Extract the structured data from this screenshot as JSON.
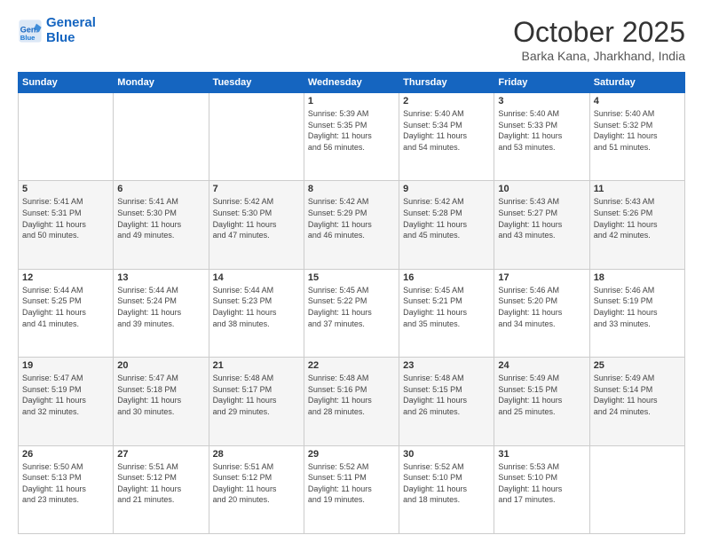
{
  "logo": {
    "line1": "General",
    "line2": "Blue"
  },
  "title": "October 2025",
  "location": "Barka Kana, Jharkhand, India",
  "days_of_week": [
    "Sunday",
    "Monday",
    "Tuesday",
    "Wednesday",
    "Thursday",
    "Friday",
    "Saturday"
  ],
  "weeks": [
    [
      {
        "day": "",
        "text": ""
      },
      {
        "day": "",
        "text": ""
      },
      {
        "day": "",
        "text": ""
      },
      {
        "day": "1",
        "text": "Sunrise: 5:39 AM\nSunset: 5:35 PM\nDaylight: 11 hours\nand 56 minutes."
      },
      {
        "day": "2",
        "text": "Sunrise: 5:40 AM\nSunset: 5:34 PM\nDaylight: 11 hours\nand 54 minutes."
      },
      {
        "day": "3",
        "text": "Sunrise: 5:40 AM\nSunset: 5:33 PM\nDaylight: 11 hours\nand 53 minutes."
      },
      {
        "day": "4",
        "text": "Sunrise: 5:40 AM\nSunset: 5:32 PM\nDaylight: 11 hours\nand 51 minutes."
      }
    ],
    [
      {
        "day": "5",
        "text": "Sunrise: 5:41 AM\nSunset: 5:31 PM\nDaylight: 11 hours\nand 50 minutes."
      },
      {
        "day": "6",
        "text": "Sunrise: 5:41 AM\nSunset: 5:30 PM\nDaylight: 11 hours\nand 49 minutes."
      },
      {
        "day": "7",
        "text": "Sunrise: 5:42 AM\nSunset: 5:30 PM\nDaylight: 11 hours\nand 47 minutes."
      },
      {
        "day": "8",
        "text": "Sunrise: 5:42 AM\nSunset: 5:29 PM\nDaylight: 11 hours\nand 46 minutes."
      },
      {
        "day": "9",
        "text": "Sunrise: 5:42 AM\nSunset: 5:28 PM\nDaylight: 11 hours\nand 45 minutes."
      },
      {
        "day": "10",
        "text": "Sunrise: 5:43 AM\nSunset: 5:27 PM\nDaylight: 11 hours\nand 43 minutes."
      },
      {
        "day": "11",
        "text": "Sunrise: 5:43 AM\nSunset: 5:26 PM\nDaylight: 11 hours\nand 42 minutes."
      }
    ],
    [
      {
        "day": "12",
        "text": "Sunrise: 5:44 AM\nSunset: 5:25 PM\nDaylight: 11 hours\nand 41 minutes."
      },
      {
        "day": "13",
        "text": "Sunrise: 5:44 AM\nSunset: 5:24 PM\nDaylight: 11 hours\nand 39 minutes."
      },
      {
        "day": "14",
        "text": "Sunrise: 5:44 AM\nSunset: 5:23 PM\nDaylight: 11 hours\nand 38 minutes."
      },
      {
        "day": "15",
        "text": "Sunrise: 5:45 AM\nSunset: 5:22 PM\nDaylight: 11 hours\nand 37 minutes."
      },
      {
        "day": "16",
        "text": "Sunrise: 5:45 AM\nSunset: 5:21 PM\nDaylight: 11 hours\nand 35 minutes."
      },
      {
        "day": "17",
        "text": "Sunrise: 5:46 AM\nSunset: 5:20 PM\nDaylight: 11 hours\nand 34 minutes."
      },
      {
        "day": "18",
        "text": "Sunrise: 5:46 AM\nSunset: 5:19 PM\nDaylight: 11 hours\nand 33 minutes."
      }
    ],
    [
      {
        "day": "19",
        "text": "Sunrise: 5:47 AM\nSunset: 5:19 PM\nDaylight: 11 hours\nand 32 minutes."
      },
      {
        "day": "20",
        "text": "Sunrise: 5:47 AM\nSunset: 5:18 PM\nDaylight: 11 hours\nand 30 minutes."
      },
      {
        "day": "21",
        "text": "Sunrise: 5:48 AM\nSunset: 5:17 PM\nDaylight: 11 hours\nand 29 minutes."
      },
      {
        "day": "22",
        "text": "Sunrise: 5:48 AM\nSunset: 5:16 PM\nDaylight: 11 hours\nand 28 minutes."
      },
      {
        "day": "23",
        "text": "Sunrise: 5:48 AM\nSunset: 5:15 PM\nDaylight: 11 hours\nand 26 minutes."
      },
      {
        "day": "24",
        "text": "Sunrise: 5:49 AM\nSunset: 5:15 PM\nDaylight: 11 hours\nand 25 minutes."
      },
      {
        "day": "25",
        "text": "Sunrise: 5:49 AM\nSunset: 5:14 PM\nDaylight: 11 hours\nand 24 minutes."
      }
    ],
    [
      {
        "day": "26",
        "text": "Sunrise: 5:50 AM\nSunset: 5:13 PM\nDaylight: 11 hours\nand 23 minutes."
      },
      {
        "day": "27",
        "text": "Sunrise: 5:51 AM\nSunset: 5:12 PM\nDaylight: 11 hours\nand 21 minutes."
      },
      {
        "day": "28",
        "text": "Sunrise: 5:51 AM\nSunset: 5:12 PM\nDaylight: 11 hours\nand 20 minutes."
      },
      {
        "day": "29",
        "text": "Sunrise: 5:52 AM\nSunset: 5:11 PM\nDaylight: 11 hours\nand 19 minutes."
      },
      {
        "day": "30",
        "text": "Sunrise: 5:52 AM\nSunset: 5:10 PM\nDaylight: 11 hours\nand 18 minutes."
      },
      {
        "day": "31",
        "text": "Sunrise: 5:53 AM\nSunset: 5:10 PM\nDaylight: 11 hours\nand 17 minutes."
      },
      {
        "day": "",
        "text": ""
      }
    ]
  ]
}
